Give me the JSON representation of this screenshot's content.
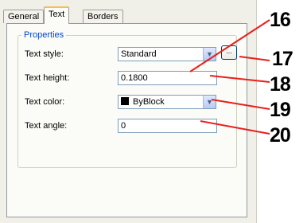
{
  "tabs": [
    {
      "label": "General",
      "active": false
    },
    {
      "label": "Text",
      "active": true
    },
    {
      "label": "Borders",
      "active": false
    }
  ],
  "group_title": "Properties",
  "fields": {
    "text_style": {
      "label": "Text style:",
      "value": "Standard"
    },
    "text_height": {
      "label": "Text height:",
      "value": "0.1800"
    },
    "text_color": {
      "label": "Text color:",
      "value": "ByBlock",
      "swatch": "#000000"
    },
    "text_angle": {
      "label": "Text angle:",
      "value": "0"
    }
  },
  "browse_button_label": "...",
  "callouts": [
    "16",
    "17",
    "18",
    "19",
    "20"
  ],
  "colors": {
    "callout_line": "#e8201a",
    "group_title": "#0046d5",
    "active_tab_accent": "#f7bd5a"
  }
}
